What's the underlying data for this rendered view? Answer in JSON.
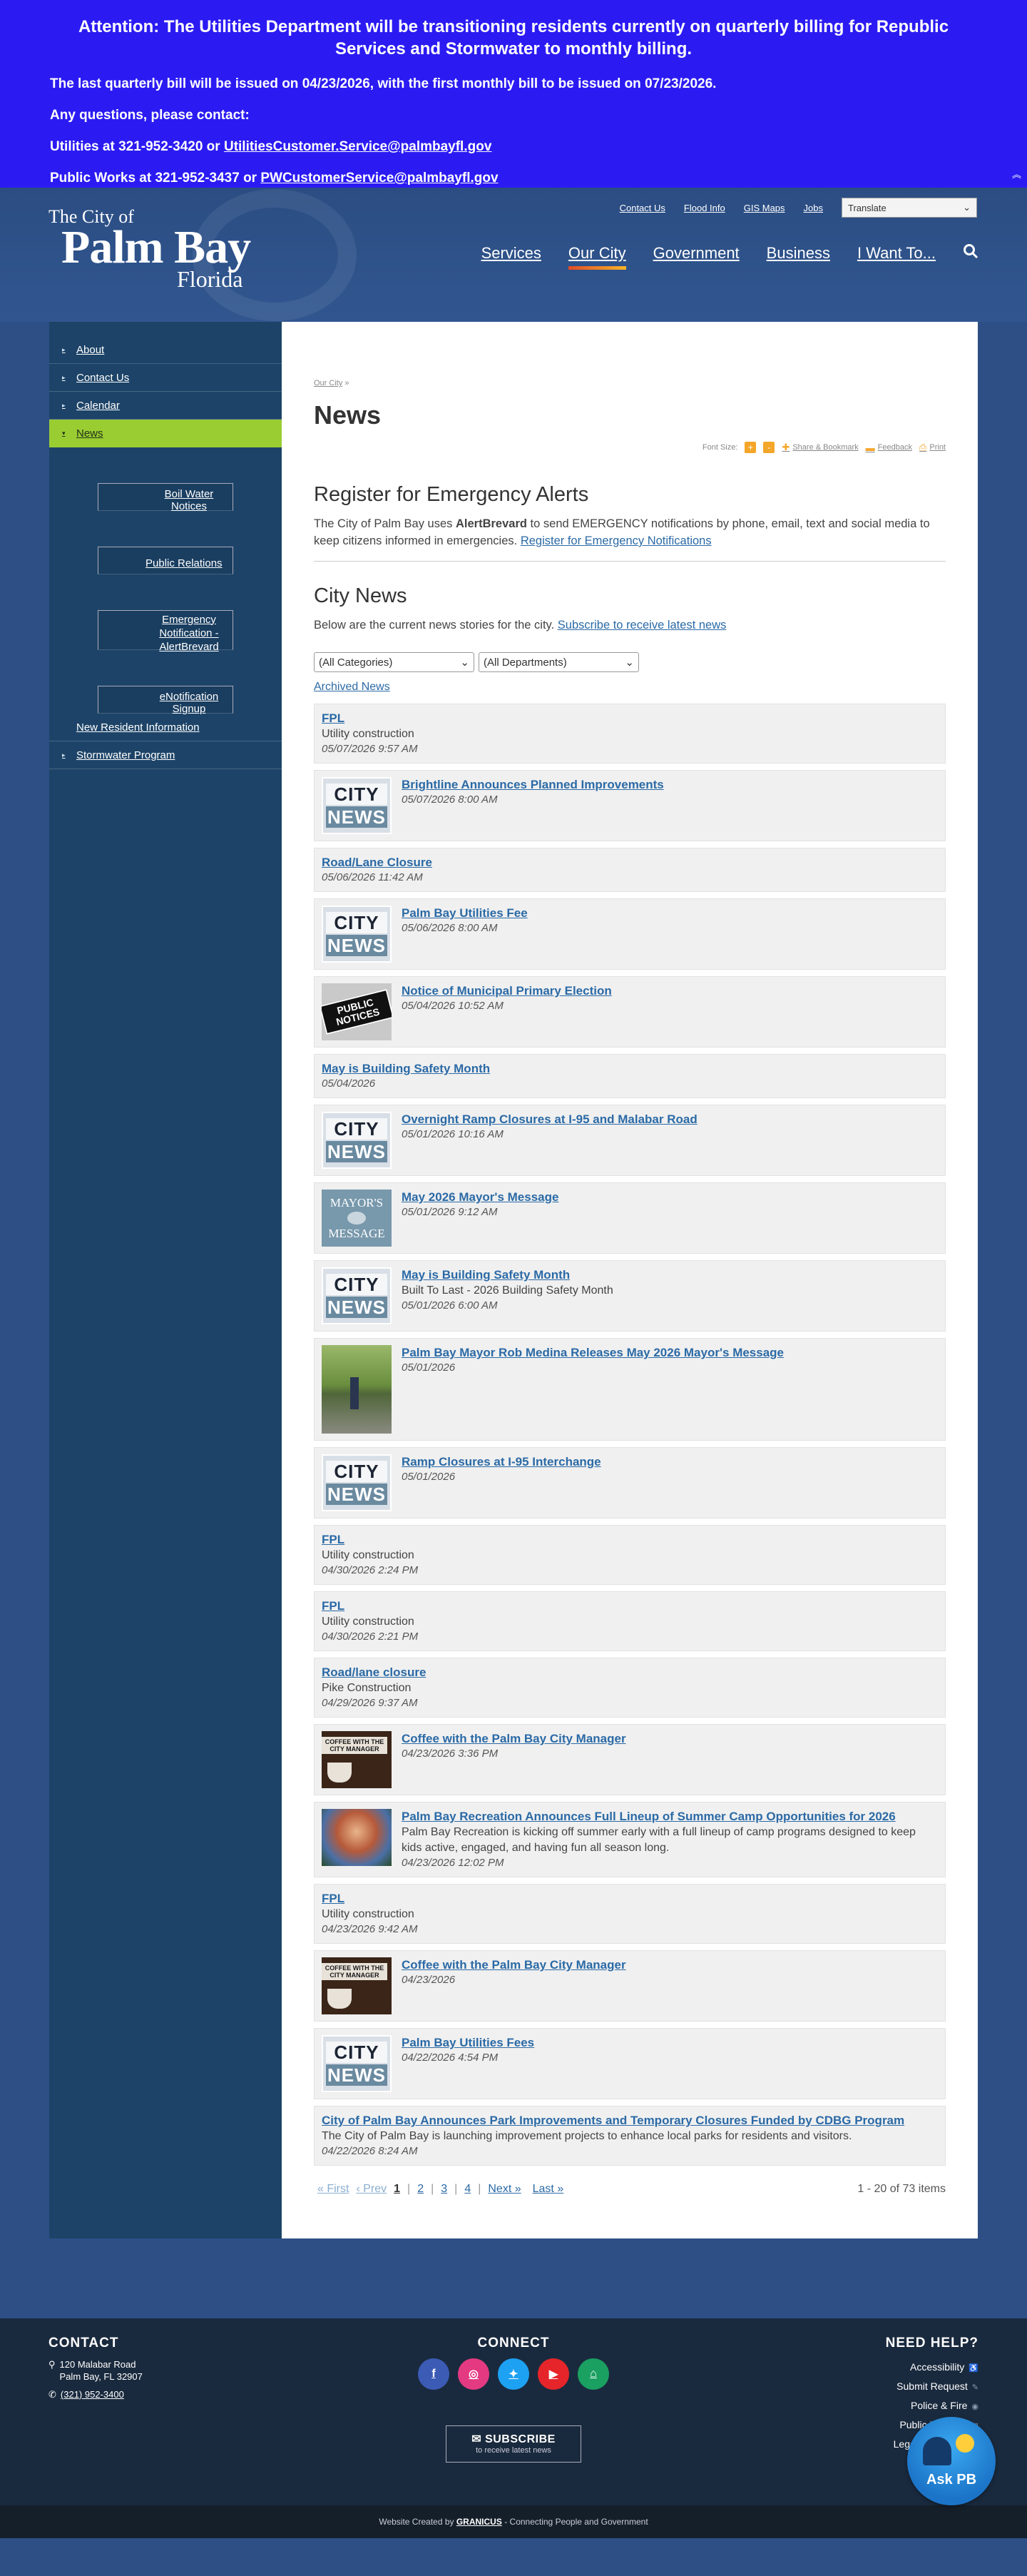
{
  "alert": {
    "headline": "Attention: The Utilities Department will be transitioning residents currently on quarterly billing for Republic Services and Stormwater to monthly billing.",
    "line1": "The last quarterly bill will be issued on 04/23/2026, with the first monthly bill to be issued on 07/23/2026.",
    "line2": "Any questions, please contact:",
    "line3_prefix": "Utilities at 321-952-3420 or ",
    "line3_email": "UtilitiesCustomer.Service@palmbayfl.gov",
    "line4_prefix": "Public Works at 321-952-3437 or ",
    "line4_email": "PWCustomerService@palmbayfl.gov",
    "collapse_icon": "chevron-double-up-icon"
  },
  "logo": {
    "line1": "The City of",
    "line2": "Palm Bay",
    "line3": "Florida"
  },
  "utility_nav": [
    "Contact Us",
    "Flood Info",
    "GIS Maps",
    "Jobs"
  ],
  "translate_label": "Translate",
  "main_nav": [
    "Services",
    "Our City",
    "Government",
    "Business",
    "I Want To..."
  ],
  "sidebar": {
    "about": "About",
    "contact": "Contact Us",
    "calendar": "Calendar",
    "news": "News",
    "boil": "Boil Water Notices",
    "pr": "Public Relations",
    "emergency": "Emergency Notification - AlertBrevard",
    "enotify": "eNotification Signup",
    "newres": "New Resident Information",
    "storm": "Stormwater Program"
  },
  "breadcrumb": {
    "link": "Our City",
    "sep": "»"
  },
  "page_title": "News",
  "tools": {
    "font_size": "Font Size:",
    "plus": "+",
    "minus": "-",
    "share": "Share & Bookmark",
    "feedback": "Feedback",
    "print": "Print"
  },
  "emergency": {
    "title": "Register for Emergency Alerts",
    "text1": "The City of Palm Bay uses ",
    "bold": "AlertBrevard",
    "text2": " to send EMERGENCY notifications by phone, email, text and social media to keep citizens informed in emergencies. ",
    "link": "Register for Emergency Notifications"
  },
  "city_news": {
    "title": "City News",
    "intro": "Below are the current news stories for the city. ",
    "subscribe_link": "Subscribe to receive latest news",
    "filter_categories": "(All Categories)",
    "filter_departments": "(All Departments)",
    "archived": "Archived News"
  },
  "thumb_text": {
    "city": "CITY",
    "news": "NEWS",
    "public": "PUBLIC NOTICES",
    "mayors": "MAYOR'S",
    "message": "MESSAGE",
    "coffee": "COFFEE WITH THE CITY MANAGER"
  },
  "news": [
    {
      "title": "FPL",
      "desc": "Utility construction",
      "date": "05/07/2026 9:57 AM",
      "thumb": ""
    },
    {
      "title": "Brightline Announces Planned Improvements",
      "desc": "",
      "date": "05/07/2026 8:00 AM",
      "thumb": "city"
    },
    {
      "title": "Road/Lane Closure",
      "desc": "",
      "date": "05/06/2026 11:42 AM",
      "thumb": ""
    },
    {
      "title": "Palm Bay Utilities Fee",
      "desc": "",
      "date": "05/06/2026 8:00 AM",
      "thumb": "city"
    },
    {
      "title": "Notice of Municipal Primary Election",
      "desc": "",
      "date": "05/04/2026 10:52 AM",
      "thumb": "public"
    },
    {
      "title": "May is Building Safety Month",
      "desc": "",
      "date": "05/04/2026",
      "thumb": ""
    },
    {
      "title": "Overnight Ramp Closures at I-95 and Malabar Road",
      "desc": "",
      "date": "05/01/2026 10:16 AM",
      "thumb": "city"
    },
    {
      "title": "May 2026 Mayor's Message",
      "desc": "",
      "date": "05/01/2026 9:12 AM",
      "thumb": "mayor"
    },
    {
      "title": "May is Building Safety Month",
      "desc": "Built To Last - 2026 Building Safety Month",
      "date": "05/01/2026 6:00 AM",
      "thumb": "city"
    },
    {
      "title": "Palm Bay Mayor Rob Medina Releases May 2026 Mayor's Message",
      "desc": "",
      "date": "05/01/2026",
      "thumb": "photo"
    },
    {
      "title": "Ramp Closures at I-95 Interchange",
      "desc": "",
      "date": "05/01/2026",
      "thumb": "city"
    },
    {
      "title": "FPL",
      "desc": "Utility construction",
      "date": "04/30/2026 2:24 PM",
      "thumb": ""
    },
    {
      "title": "FPL",
      "desc": "Utility construction",
      "date": "04/30/2026 2:21 PM",
      "thumb": ""
    },
    {
      "title": "Road/lane closure",
      "desc": "Pike Construction",
      "date": "04/29/2026 9:37 AM",
      "thumb": ""
    },
    {
      "title": "Coffee with the Palm Bay City Manager",
      "desc": "",
      "date": "04/23/2026 3:36 PM",
      "thumb": "coffee"
    },
    {
      "title": "Palm Bay Recreation Announces Full Lineup of Summer Camp Opportunities for 2026",
      "desc": "Palm Bay Recreation is kicking off summer early with a full lineup of camp programs designed to keep kids active, engaged, and having fun all season long.",
      "date": "04/23/2026 12:02 PM",
      "thumb": "kids"
    },
    {
      "title": "FPL",
      "desc": "Utility construction",
      "date": "04/23/2026 9:42 AM",
      "thumb": ""
    },
    {
      "title": "Coffee with the Palm Bay City Manager",
      "desc": "",
      "date": "04/23/2026",
      "thumb": "coffee"
    },
    {
      "title": "Palm Bay Utilities Fees",
      "desc": "",
      "date": "04/22/2026 4:54 PM",
      "thumb": "city"
    },
    {
      "title": "City of Palm Bay Announces Park Improvements and Temporary Closures Funded by CDBG Program",
      "desc": "The City of Palm Bay is launching improvement projects to enhance local parks for residents and visitors.",
      "date": "04/22/2026 8:24 AM",
      "thumb": ""
    }
  ],
  "pager": {
    "first": "« First",
    "prev": "‹ Prev",
    "pages": [
      "1",
      "2",
      "3",
      "4"
    ],
    "current": "1",
    "next": "Next »",
    "last": "Last »",
    "summary": "1 - 20 of 73 items"
  },
  "footer": {
    "contact_title": "CONTACT",
    "address1": "120 Malabar Road",
    "address2": "Palm Bay, FL 32907",
    "phone": "(321) 952-3400",
    "connect_title": "CONNECT",
    "socials": [
      {
        "name": "facebook-icon",
        "glyph": "f",
        "color": "#3b5bb5"
      },
      {
        "name": "instagram-icon",
        "glyph": "◎",
        "color": "#e43a82"
      },
      {
        "name": "twitter-icon",
        "glyph": "✦",
        "color": "#1da1f2"
      },
      {
        "name": "youtube-icon",
        "glyph": "▶",
        "color": "#e5252a"
      },
      {
        "name": "nextdoor-icon",
        "glyph": "⌂",
        "color": "#1aa061"
      }
    ],
    "subscribe": "SUBSCRIBE",
    "subscribe_sub": "to receive latest news",
    "help_title": "NEED HELP?",
    "help_links": [
      "Accessibility",
      "Submit Request",
      "Police & Fire",
      "Public Records",
      "Legal Disclaimer"
    ],
    "ask_pb": "Ask PB",
    "credit_prefix": "Website Created by ",
    "credit_brand": "GRANICUS",
    "credit_suffix": " - Connecting People and Government"
  },
  "colors": {
    "alert_bg": "#2b1bf2",
    "header_bg": "#2b4d83",
    "sidebar_bg": "#1d4468",
    "sidebar_active": "#9acd32",
    "link": "#2b6aa6",
    "accent": "#f4a62a"
  }
}
